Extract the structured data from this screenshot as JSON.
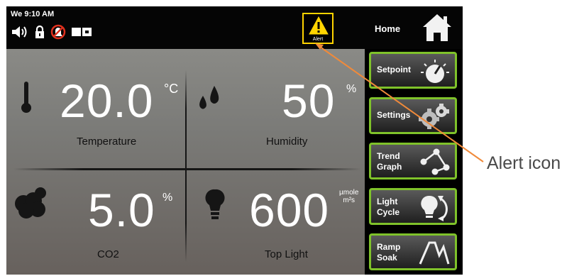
{
  "status_bar": {
    "time": "We 9:10 AM",
    "icons": [
      "speaker-icon",
      "lock-icon",
      "alarm-off-icon",
      "battery-icon"
    ],
    "alert_label": "Alert",
    "home_label": "Home"
  },
  "readings": {
    "temperature": {
      "value": "20.0",
      "unit": "°C",
      "label": "Temperature"
    },
    "humidity": {
      "value": "50",
      "unit": "%",
      "label": "Humidity"
    },
    "co2": {
      "value": "5.0",
      "unit": "%",
      "label": "CO2"
    },
    "light": {
      "value": "600",
      "unit_top": "µmole",
      "unit_bottom": "m²s",
      "label": "Top Light"
    }
  },
  "sidebar": {
    "buttons": [
      {
        "line1": "Setpoint",
        "line2": "",
        "icon": "dial-icon"
      },
      {
        "line1": "Settings",
        "line2": "",
        "icon": "gears-icon"
      },
      {
        "line1": "Trend",
        "line2": "Graph",
        "icon": "trend-graph-icon"
      },
      {
        "line1": "Light",
        "line2": "Cycle",
        "icon": "light-cycle-icon"
      },
      {
        "line1": "Ramp",
        "line2": "Soak",
        "icon": "ramp-soak-icon"
      }
    ]
  },
  "annotation": {
    "text": "Alert icon"
  },
  "colors": {
    "accent": "#7fc22a",
    "alert": "#ffd400",
    "annotation_line": "#f08a3a"
  }
}
